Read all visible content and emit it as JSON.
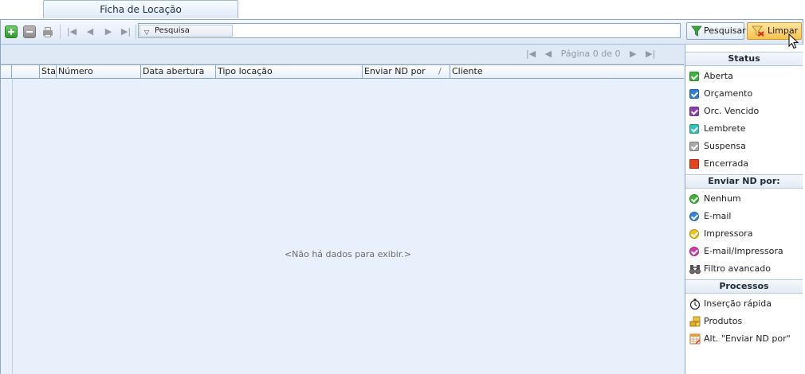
{
  "tab": {
    "label": "Ficha de Locação"
  },
  "toolbar": {
    "search_label": "Pesquisa",
    "search_value": "",
    "pesquisar_label": "Pesquisar",
    "limpar_label": "Limpar"
  },
  "pager": {
    "first": "|◀",
    "prev": "◀",
    "text": "Página 0 de 0",
    "next": "▶",
    "last": "▶|"
  },
  "grid": {
    "columns": [
      "Sta",
      "Número",
      "Data abertura",
      "Tipo locação",
      "Enviar ND por",
      "Cliente"
    ],
    "sort_glyph": "/",
    "empty_message": "<Não há dados para exibir.>"
  },
  "side": {
    "status": {
      "title": "Status",
      "items": [
        {
          "label": "Aberta",
          "color": "#3bb53b"
        },
        {
          "label": "Orçamento",
          "color": "#2f7fd8"
        },
        {
          "label": "Orc. Vencido",
          "color": "#8a3fb5"
        },
        {
          "label": "Lembrete",
          "color": "#2ec4b8"
        },
        {
          "label": "Suspensa",
          "color": "#a9a9a9"
        },
        {
          "label": "Encerrada",
          "color": "#e5431b"
        }
      ]
    },
    "enviar": {
      "title": "Enviar ND por:",
      "items": [
        {
          "label": "Nenhum",
          "color": "#39b534"
        },
        {
          "label": "E-mail",
          "color": "#2f86d8"
        },
        {
          "label": "Impressora",
          "color": "#f0c419"
        },
        {
          "label": "E-mail/Impressora",
          "color": "#d63aa8"
        },
        {
          "label": "Filtro avancado",
          "icon": "binoculars-icon"
        }
      ]
    },
    "processos": {
      "title": "Processos",
      "items": [
        {
          "label": "Inserção rápida",
          "icon": "stopwatch-icon"
        },
        {
          "label": "Produtos",
          "icon": "boxes-icon"
        },
        {
          "label": "Alt. \"Enviar ND por\"",
          "icon": "table-edit-icon"
        }
      ]
    }
  }
}
